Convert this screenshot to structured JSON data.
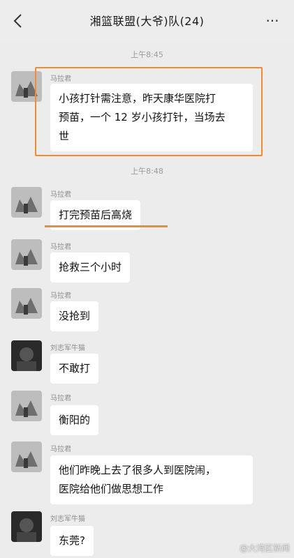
{
  "header": {
    "title": "湘篮联盟(大爷)队(24)",
    "back_icon": "chevron-left-icon",
    "more_icon": "more-dots-icon",
    "more_glyph": "···"
  },
  "times": {
    "t1": "上午8:45",
    "t2": "上午8:48"
  },
  "messages": [
    {
      "sender": "马拉君",
      "lines": [
        "小孩打针需注意，昨天康华医院打",
        "预苗，一个 12 岁小孩打针，当场去",
        "世"
      ]
    },
    {
      "sender": "马拉君",
      "text": "打完预苗后高烧"
    },
    {
      "sender": "马拉君",
      "text": "抢救三个小时"
    },
    {
      "sender": "马拉君",
      "text": "没抢到"
    },
    {
      "sender": "刘志军牛猫",
      "text": "不敢打"
    },
    {
      "sender": "马拉君",
      "text": "衡阳的"
    },
    {
      "sender": "马拉君",
      "lines": [
        "他们昨晚上去了很多人到医院闹，",
        "医院给他们做思想工作"
      ]
    },
    {
      "sender": "刘志军牛猫",
      "text": "东莞?"
    }
  ],
  "watermark": "@大湾区新闻",
  "colors": {
    "highlight": "#f08c2e",
    "bubble": "#ffffff",
    "background": "#ececec"
  }
}
